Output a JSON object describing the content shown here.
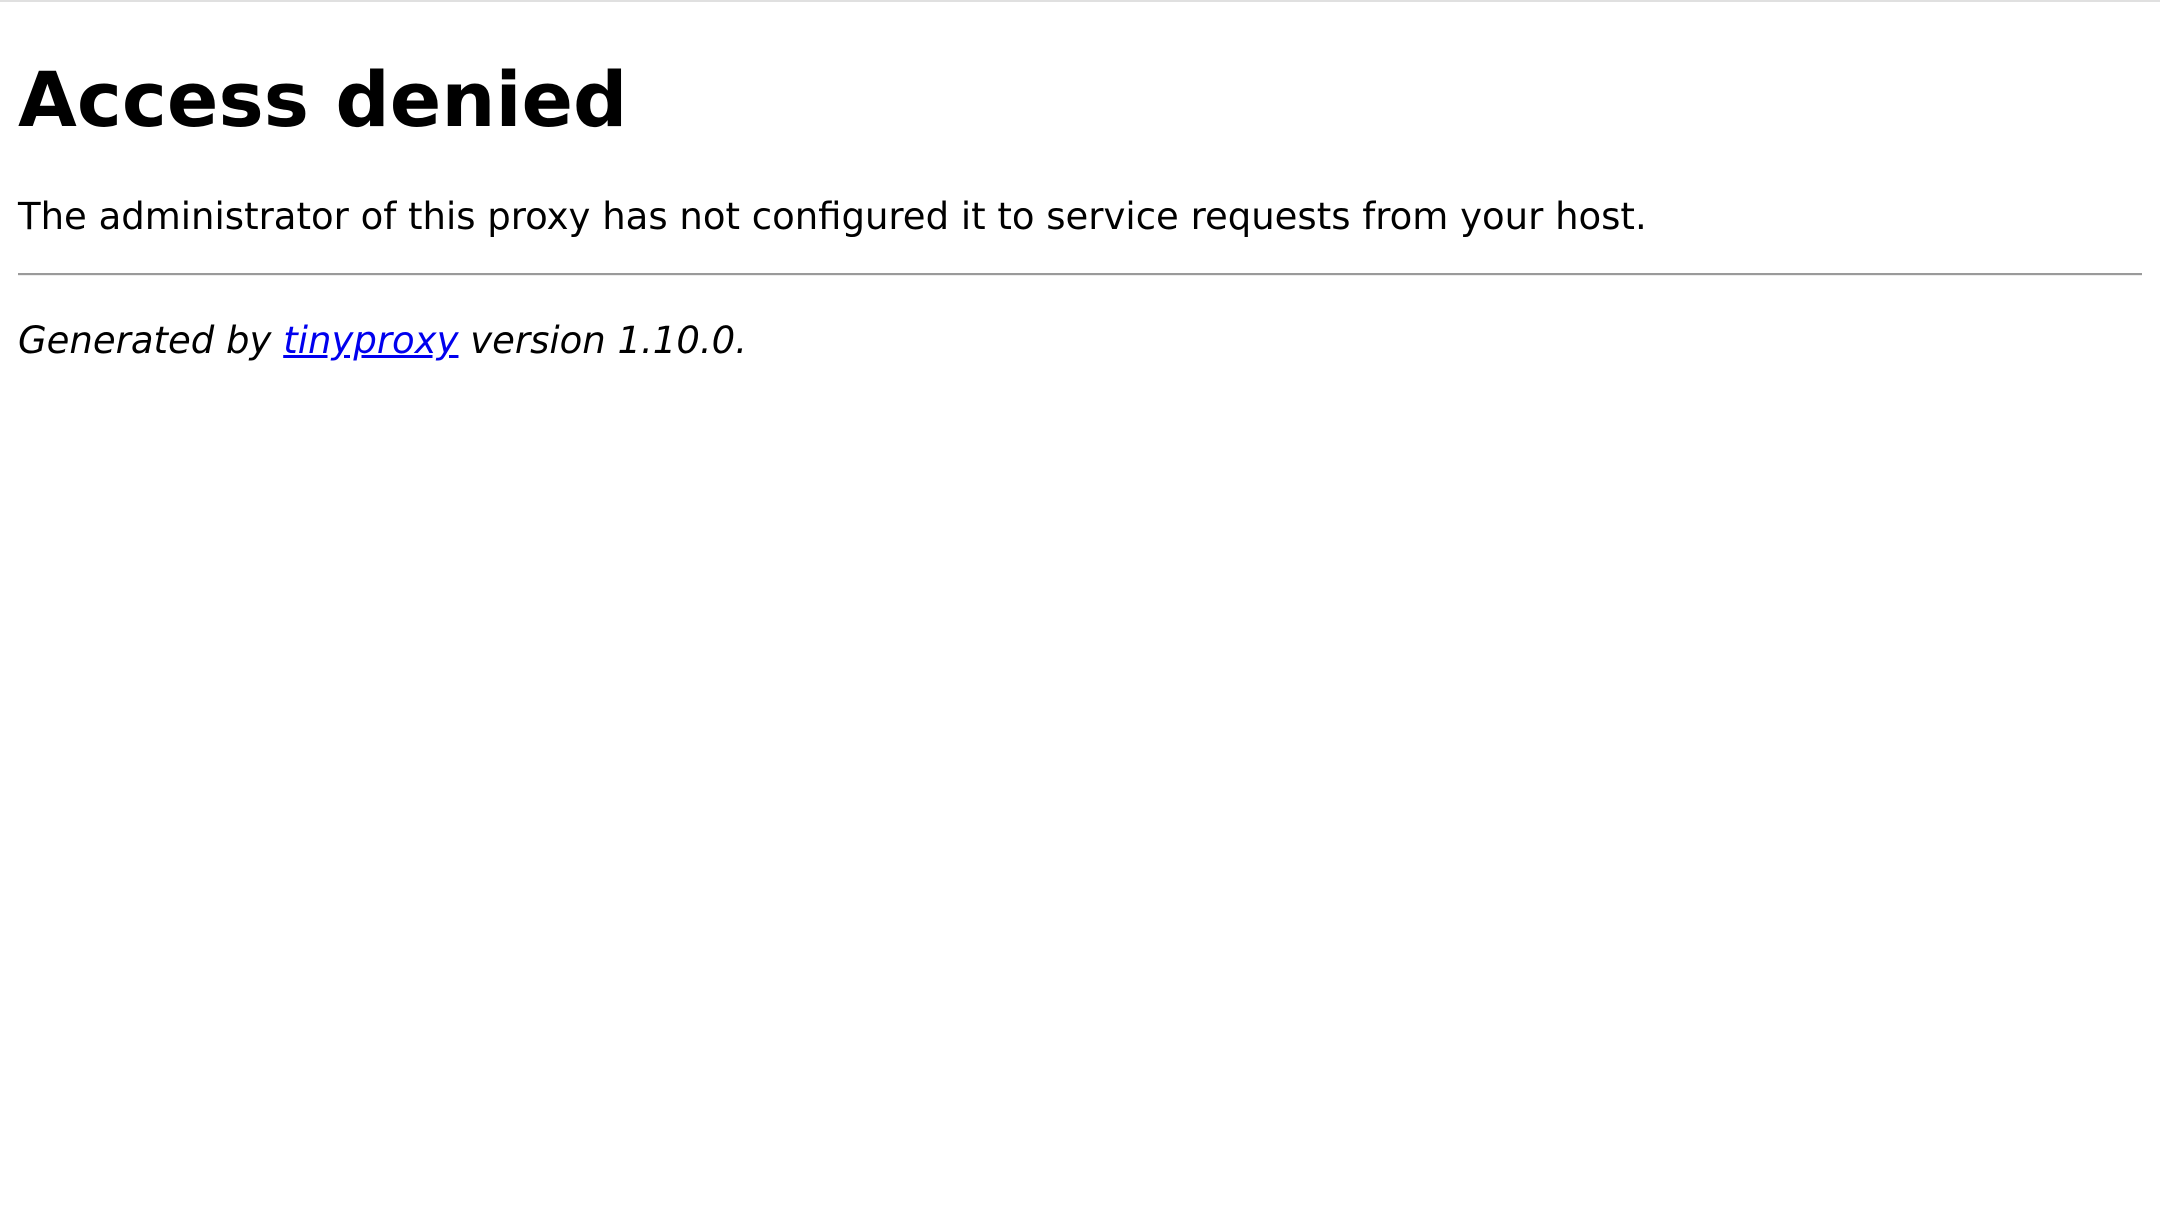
{
  "page": {
    "title": "Access denied",
    "message": "The administrator of this proxy has not configured it to service requests from your host."
  },
  "footer": {
    "prefix": "Generated by ",
    "link_text": "tinyproxy",
    "suffix": " version 1.10.0."
  },
  "colors": {
    "link": "#0000ee",
    "text": "#000000",
    "background": "#ffffff",
    "divider": "#9a9a9a"
  }
}
